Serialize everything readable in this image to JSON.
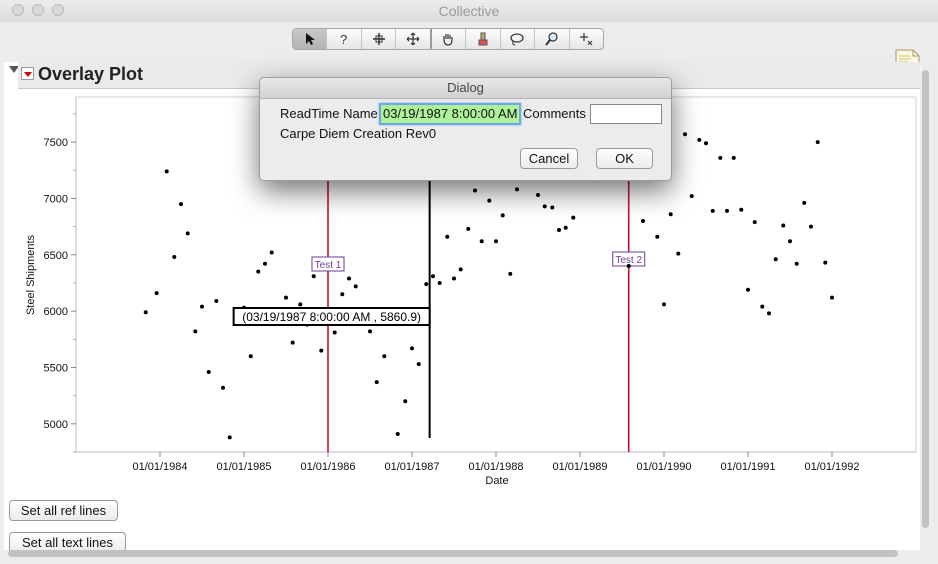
{
  "window": {
    "title": "Collective"
  },
  "toolbar": {
    "tools": [
      "arrow-tool",
      "help-tool",
      "selection-tool",
      "crosshair-move-tool",
      "grabber-tool",
      "brush-tool",
      "lasso-tool",
      "magnifier-tool",
      "annotate-tool"
    ]
  },
  "report": {
    "title": "Overlay Plot"
  },
  "chart_data": {
    "type": "scatter",
    "xlabel": "Date",
    "ylabel": "Steel Shipments",
    "x_ticks": [
      "01/01/1984",
      "01/01/1985",
      "01/01/1986",
      "01/01/1987",
      "01/01/1988",
      "01/01/1989",
      "01/01/1990",
      "01/01/1991",
      "01/01/1992"
    ],
    "y_ticks": [
      5000,
      5500,
      6000,
      6500,
      7000,
      7500
    ],
    "xlim": [
      1983.0,
      1993.0
    ],
    "ylim": [
      4750,
      7900
    ],
    "grid": false,
    "points": [
      [
        1983.83,
        5990
      ],
      [
        1983.96,
        6160
      ],
      [
        1984.08,
        7240
      ],
      [
        1984.17,
        6480
      ],
      [
        1984.25,
        6950
      ],
      [
        1984.33,
        6690
      ],
      [
        1984.42,
        5820
      ],
      [
        1984.5,
        6040
      ],
      [
        1984.58,
        5460
      ],
      [
        1984.67,
        6090
      ],
      [
        1984.75,
        5320
      ],
      [
        1984.83,
        4880
      ],
      [
        1984.92,
        5980
      ],
      [
        1985.0,
        6030
      ],
      [
        1985.08,
        5600
      ],
      [
        1985.17,
        6350
      ],
      [
        1985.25,
        6420
      ],
      [
        1985.33,
        6520
      ],
      [
        1985.42,
        5990
      ],
      [
        1985.5,
        6120
      ],
      [
        1985.58,
        5720
      ],
      [
        1985.67,
        6060
      ],
      [
        1985.75,
        5880
      ],
      [
        1985.83,
        6310
      ],
      [
        1985.92,
        5650
      ],
      [
        1986.0,
        5980
      ],
      [
        1986.08,
        5810
      ],
      [
        1986.17,
        6150
      ],
      [
        1986.25,
        6290
      ],
      [
        1986.33,
        6220
      ],
      [
        1986.42,
        6010
      ],
      [
        1986.5,
        5820
      ],
      [
        1986.58,
        5370
      ],
      [
        1986.67,
        5600
      ],
      [
        1986.75,
        5920
      ],
      [
        1986.83,
        4910
      ],
      [
        1986.92,
        5200
      ],
      [
        1987.0,
        5670
      ],
      [
        1987.08,
        5530
      ],
      [
        1987.17,
        6240
      ],
      [
        1987.25,
        6310
      ],
      [
        1987.33,
        6250
      ],
      [
        1987.42,
        6660
      ],
      [
        1987.5,
        6290
      ],
      [
        1987.58,
        6370
      ],
      [
        1987.67,
        6730
      ],
      [
        1987.75,
        7070
      ],
      [
        1987.83,
        6620
      ],
      [
        1987.92,
        6980
      ],
      [
        1988.0,
        6620
      ],
      [
        1988.08,
        6850
      ],
      [
        1988.17,
        6330
      ],
      [
        1988.25,
        7080
      ],
      [
        1988.33,
        7190
      ],
      [
        1988.5,
        7030
      ],
      [
        1988.58,
        6930
      ],
      [
        1988.67,
        6920
      ],
      [
        1988.75,
        6720
      ],
      [
        1988.83,
        6740
      ],
      [
        1988.92,
        6830
      ],
      [
        1989.17,
        7170
      ],
      [
        1989.58,
        6400
      ],
      [
        1989.67,
        7230
      ],
      [
        1989.75,
        6800
      ],
      [
        1989.83,
        7180
      ],
      [
        1989.92,
        6660
      ],
      [
        1990.0,
        6060
      ],
      [
        1990.08,
        6860
      ],
      [
        1990.17,
        6510
      ],
      [
        1990.25,
        7570
      ],
      [
        1990.33,
        7020
      ],
      [
        1990.42,
        7520
      ],
      [
        1990.5,
        7490
      ],
      [
        1990.58,
        6890
      ],
      [
        1990.67,
        7360
      ],
      [
        1990.75,
        6890
      ],
      [
        1990.83,
        7360
      ],
      [
        1990.92,
        6900
      ],
      [
        1991.0,
        6190
      ],
      [
        1991.08,
        6790
      ],
      [
        1991.17,
        6040
      ],
      [
        1991.25,
        5980
      ],
      [
        1991.33,
        6460
      ],
      [
        1991.42,
        6760
      ],
      [
        1991.5,
        6620
      ],
      [
        1991.58,
        6420
      ],
      [
        1991.67,
        6960
      ],
      [
        1991.75,
        6750
      ],
      [
        1991.83,
        7500
      ],
      [
        1991.92,
        6430
      ],
      [
        1992.0,
        6120
      ]
    ],
    "ref_lines": [
      {
        "label": "Test 1",
        "x": 1986.0,
        "color": "#c8102e"
      },
      {
        "label": "Test 2",
        "x": 1989.58,
        "color": "#c8102e"
      }
    ],
    "cursor": {
      "x": 1987.21,
      "label": "(03/19/1987 8:00:00 AM , 5860.9)"
    }
  },
  "buttons": {
    "set_ref_lines": "Set all ref lines",
    "set_text_lines": "Set all text lines"
  },
  "dialog": {
    "title": "Dialog",
    "readtime_label": "ReadTime Name",
    "readtime_value": "03/19/1987 8:00:00 AM",
    "comments_label": "Comments",
    "comments_value": "",
    "subtitle": "Carpe Diem Creation Rev0",
    "cancel_label": "Cancel",
    "ok_label": "OK"
  }
}
